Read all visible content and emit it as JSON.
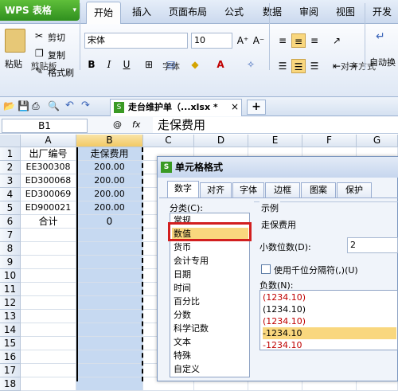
{
  "app": {
    "name": "WPS 表格",
    "menu_arrow": "▾"
  },
  "menu_tabs": [
    "开始",
    "插入",
    "页面布局",
    "公式",
    "数据",
    "审阅",
    "视图",
    "开发"
  ],
  "ribbon": {
    "clipboard": {
      "paste": "粘贴",
      "cut": "剪切",
      "copy": "复制",
      "format_painter": "格式刷",
      "label": "剪贴板"
    },
    "font": {
      "name": "宋体",
      "size": "10",
      "label": "字体",
      "bold": "B",
      "italic": "I",
      "underline": "U",
      "grow": "A⁺",
      "shrink": "A⁻"
    },
    "align": {
      "label": "对齐方式",
      "auto_wrap": "自动换"
    }
  },
  "doc_tab": {
    "title": "走台维护单（...xlsx *",
    "close": "×",
    "add": "+"
  },
  "formula_bar": {
    "name_box": "B1",
    "fx": "fx",
    "zoom": "@",
    "content": "走保费用"
  },
  "sheet": {
    "columns": [
      "A",
      "B",
      "C",
      "D",
      "E",
      "F",
      "G"
    ],
    "rows": [
      "1",
      "2",
      "3",
      "4",
      "5",
      "6",
      "7",
      "8",
      "9",
      "10",
      "11",
      "12",
      "13",
      "14",
      "15",
      "16",
      "17",
      "18"
    ],
    "data": [
      [
        "出厂编号",
        "走保费用"
      ],
      [
        "EE300308",
        "200.00"
      ],
      [
        "ED300068",
        "200.00"
      ],
      [
        "ED300069",
        "200.00"
      ],
      [
        "ED900021",
        "200.00"
      ],
      [
        "合计",
        "0"
      ]
    ]
  },
  "dialog": {
    "title": "单元格格式",
    "tabs": [
      "数字",
      "对齐",
      "字体",
      "边框",
      "图案",
      "保护"
    ],
    "category_label": "分类(C):",
    "categories": [
      "常规",
      "数值",
      "货币",
      "会计专用",
      "日期",
      "时间",
      "百分比",
      "分数",
      "科学记数",
      "文本",
      "特殊",
      "自定义"
    ],
    "selected_category": "数值",
    "sample_label": "示例",
    "sample_value": "走保费用",
    "decimal_label": "小数位数(D):",
    "decimal_value": "2",
    "thousands_label": "使用千位分隔符(,)(U)",
    "negative_label": "负数(N):",
    "negative_options": [
      "(1234.10)",
      "(1234.10)",
      "(1234.10)",
      "-1234.10",
      "-1234.10"
    ]
  },
  "colors": {
    "accent_green": "#3a9a24",
    "selected_col": "#c6d9f1",
    "highlight": "#d21f1f",
    "neg_red": "#c00000"
  }
}
